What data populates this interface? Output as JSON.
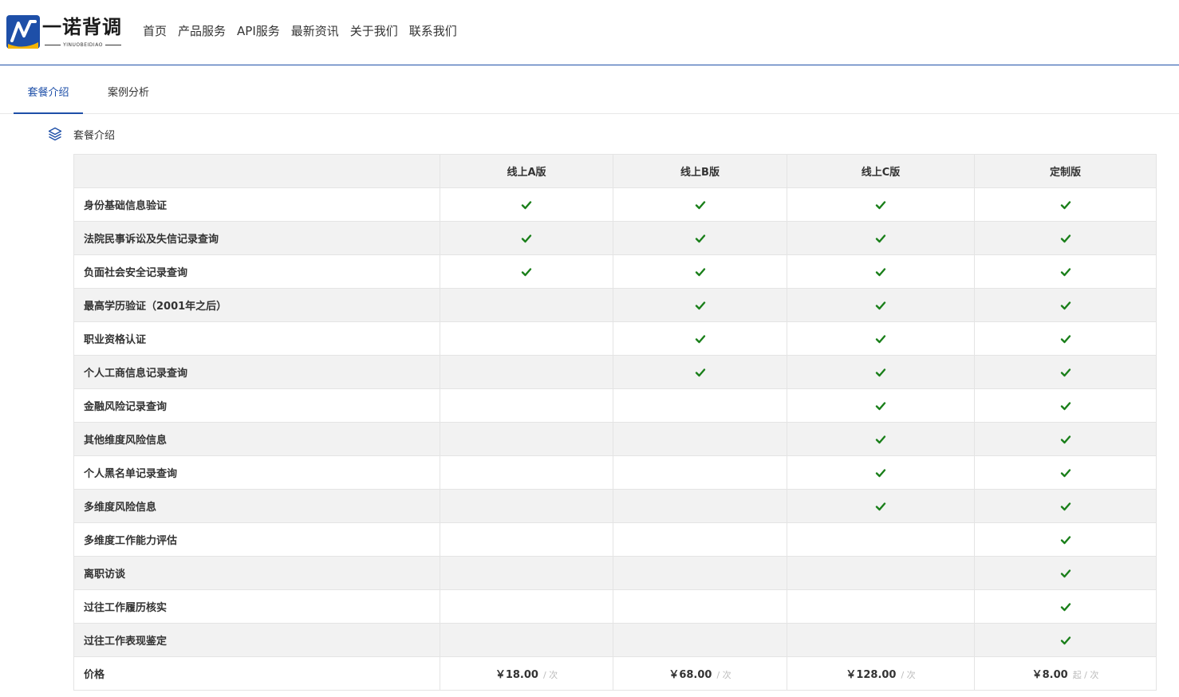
{
  "brand": {
    "name": "一诺背调",
    "sub": "YINUOBEIDIAO",
    "accent": "#1e4fa8",
    "check_color": "#1a7f1a"
  },
  "nav": [
    "首页",
    "产品服务",
    "API服务",
    "最新资讯",
    "关于我们",
    "联系我们"
  ],
  "tabs": [
    {
      "label": "套餐介绍",
      "active": true
    },
    {
      "label": "案例分析",
      "active": false
    }
  ],
  "section": {
    "title": "套餐介绍",
    "icon": "layers-icon"
  },
  "table": {
    "columns": [
      "线上A版",
      "线上B版",
      "线上C版",
      "定制版"
    ],
    "rows": [
      {
        "feature": "身份基础信息验证",
        "checks": [
          true,
          true,
          true,
          true
        ]
      },
      {
        "feature": "法院民事诉讼及失信记录查询",
        "checks": [
          true,
          true,
          true,
          true
        ]
      },
      {
        "feature": "负面社会安全记录查询",
        "checks": [
          true,
          true,
          true,
          true
        ]
      },
      {
        "feature": "最高学历验证（2001年之后）",
        "checks": [
          false,
          true,
          true,
          true
        ]
      },
      {
        "feature": "职业资格认证",
        "checks": [
          false,
          true,
          true,
          true
        ]
      },
      {
        "feature": "个人工商信息记录查询",
        "checks": [
          false,
          true,
          true,
          true
        ]
      },
      {
        "feature": "金融风险记录查询",
        "checks": [
          false,
          false,
          true,
          true
        ]
      },
      {
        "feature": "其他维度风险信息",
        "checks": [
          false,
          false,
          true,
          true
        ]
      },
      {
        "feature": "个人黑名单记录查询",
        "checks": [
          false,
          false,
          true,
          true
        ]
      },
      {
        "feature": "多维度风险信息",
        "checks": [
          false,
          false,
          true,
          true
        ]
      },
      {
        "feature": "多维度工作能力评估",
        "checks": [
          false,
          false,
          false,
          true
        ]
      },
      {
        "feature": "离职访谈",
        "checks": [
          false,
          false,
          false,
          true
        ]
      },
      {
        "feature": "过往工作履历核实",
        "checks": [
          false,
          false,
          false,
          true
        ]
      },
      {
        "feature": "过往工作表现鉴定",
        "checks": [
          false,
          false,
          false,
          true
        ]
      }
    ],
    "price_label": "价格",
    "prices": [
      {
        "amount": "￥18.00",
        "unit": "/ 次"
      },
      {
        "amount": "￥68.00",
        "unit": "/ 次"
      },
      {
        "amount": "￥128.00",
        "unit": "/ 次"
      },
      {
        "amount": "￥8.00",
        "unit": "起 / 次"
      }
    ]
  }
}
